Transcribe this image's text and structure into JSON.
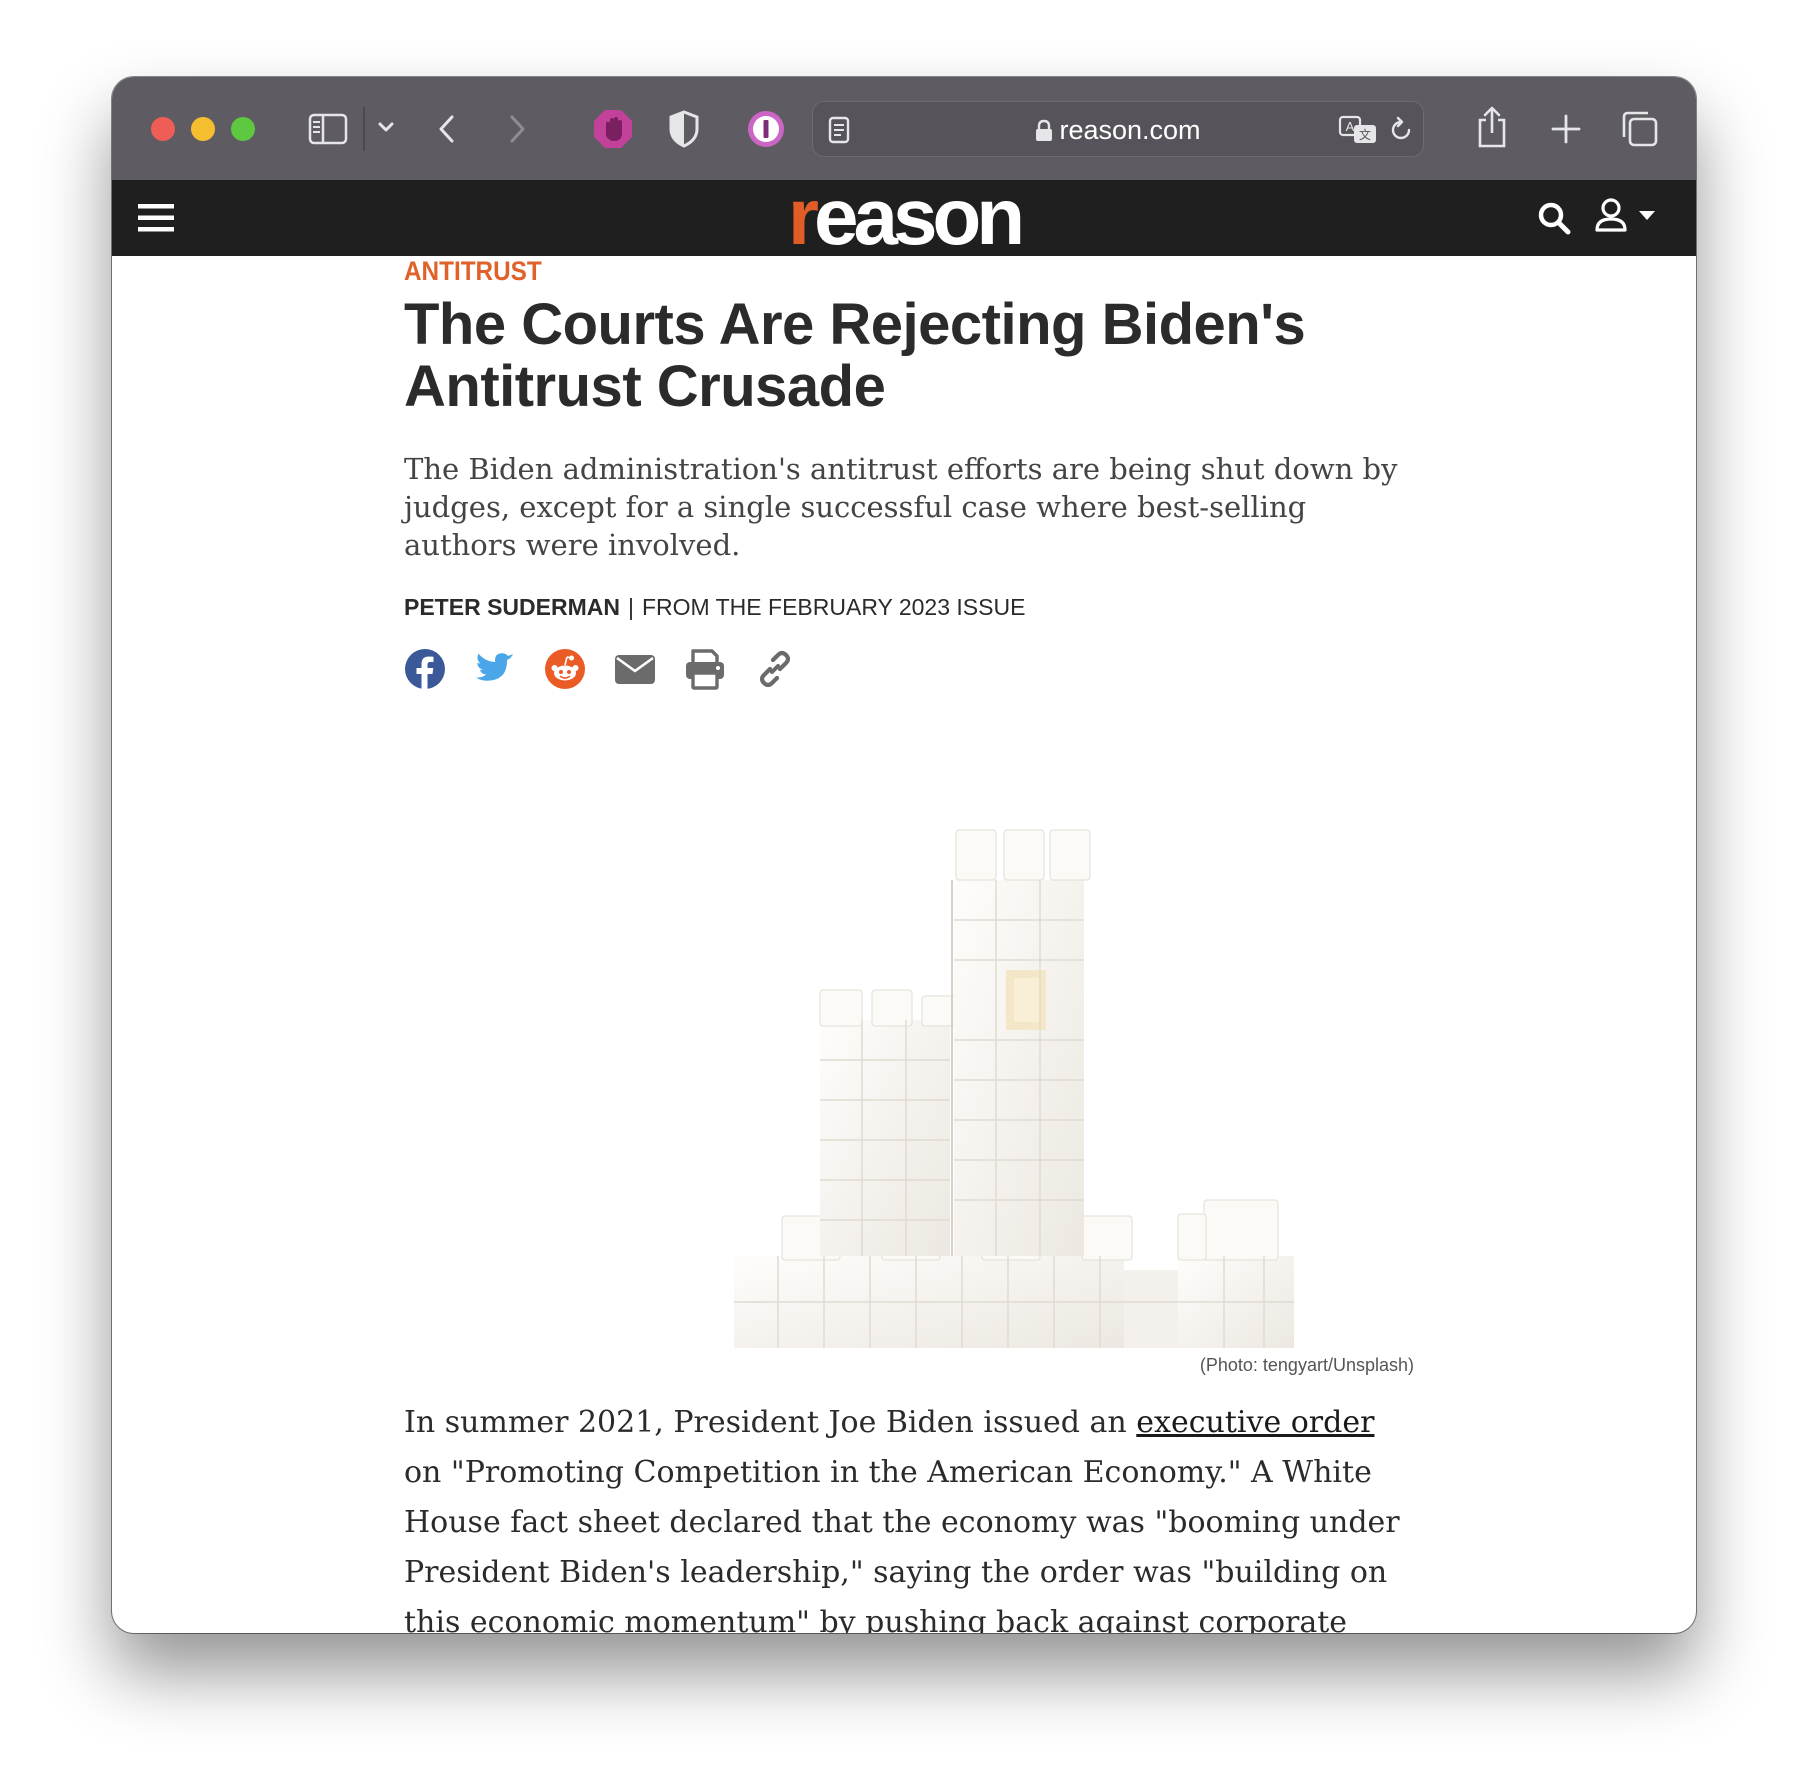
{
  "browser": {
    "url_display": "reason.com"
  },
  "site": {
    "logo_first_letter": "r",
    "logo_rest": "eason",
    "brand_color": "#e05d27",
    "nav_bg": "#1f1f1f"
  },
  "article": {
    "kicker": "ANTITRUST",
    "headline": "The Courts Are Rejecting Biden's Antitrust Crusade",
    "dek": "The Biden administration's antitrust efforts are being shut down by judges, except for a single successful case where best-selling authors were involved.",
    "author": "PETER SUDERMAN",
    "byline_separator": "|",
    "issue": "FROM THE FEBRUARY 2023 ISSUE",
    "share_icons": [
      "facebook-icon",
      "twitter-icon",
      "reddit-icon",
      "email-icon",
      "print-icon",
      "link-icon"
    ],
    "photo_caption": "(Photo: tengyart/Unsplash)",
    "body_before_link": "In summer 2021, President Joe Biden issued an ",
    "body_link": "executive order",
    "body_after_link": " on \"Promoting Competition in the American Economy.\" A White House fact sheet declared that the economy was \"booming under President Biden's leadership,\" saying the order was \"building on this economic momentum\" by pushing back against corporate consolidation, primarily through aggressive antitrust enforcement."
  }
}
